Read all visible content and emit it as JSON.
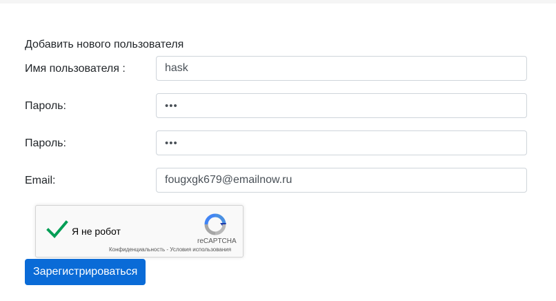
{
  "form": {
    "title": "Добавить нового пользователя",
    "fields": [
      {
        "label": "Имя пользователя :",
        "value": "hask",
        "type": "text"
      },
      {
        "label": "Пароль:",
        "value": "•••",
        "type": "password"
      },
      {
        "label": "Пароль:",
        "value": "•••",
        "type": "password"
      },
      {
        "label": "Email:",
        "value": "fougxgk679@emailnow.ru",
        "type": "email"
      }
    ],
    "submit_label": "Зарегистрироваться"
  },
  "recaptcha": {
    "label": "Я не робот",
    "checked": true,
    "brand": "reCAPTCHA",
    "privacy_link": "Конфиденциальность",
    "separator": " - ",
    "terms_link": "Условия использования",
    "icons": {
      "check": "checkmark-icon",
      "logo": "recaptcha-logo-icon"
    }
  },
  "colors": {
    "primary_button": "#0a6bd7",
    "checkmark": "#009e55",
    "input_border": "#ced4da"
  }
}
